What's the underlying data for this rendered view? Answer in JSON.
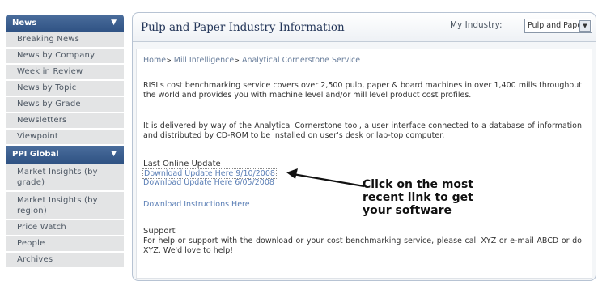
{
  "sidebar": {
    "sections": [
      {
        "title": "News",
        "arrow": "▼",
        "items": [
          "Breaking News",
          "News by Company",
          "Week in Review",
          "News by Topic",
          "News by Grade",
          "Newsletters",
          "Viewpoint"
        ]
      },
      {
        "title": "PPI Global",
        "arrow": "▼",
        "items": [
          "Market Insights (by grade)",
          "Market Insights (by region)",
          "Price Watch",
          "People",
          "Archives"
        ]
      }
    ]
  },
  "header": {
    "title": "Pulp and Paper Industry Information",
    "industry_label": "My Industry:",
    "industry_value": "Pulp and Paper"
  },
  "breadcrumb": {
    "items": [
      "Home",
      "Mill Intelligence",
      "Analytical Cornerstone Service"
    ],
    "separator": ">"
  },
  "content": {
    "para1": "RISI's cost benchmarking service covers over 2,500 pulp, paper & board machines in over 1,400 mills throughout the world and provides you with machine level and/or mill level product cost profiles.",
    "para2": "It is delivered by way of the Analytical Cornerstone tool, a user interface connected to a database of information and distributed by CD-ROM to be installed on user's desk or lap-top computer.",
    "last_update_heading": "Last Online Update",
    "link1": "Download Update Here 9/10/2008",
    "link2": "Download Update Here 6/05/2008",
    "link3": "Download Instructions Here",
    "support_heading": "Support",
    "support_text": "For help or support with the download or your cost benchmarking service, please call XYZ or e-mail ABCD or do XYZ. We'd love to help!"
  },
  "annotation": {
    "line1": "Click on the most",
    "line2": "recent link to get",
    "line3": "your software"
  },
  "colors": {
    "sidebar_header": "#3b5e8f",
    "sidebar_item_bg": "#e3e4e5",
    "link": "#5b7fb6",
    "title": "#25375a"
  }
}
